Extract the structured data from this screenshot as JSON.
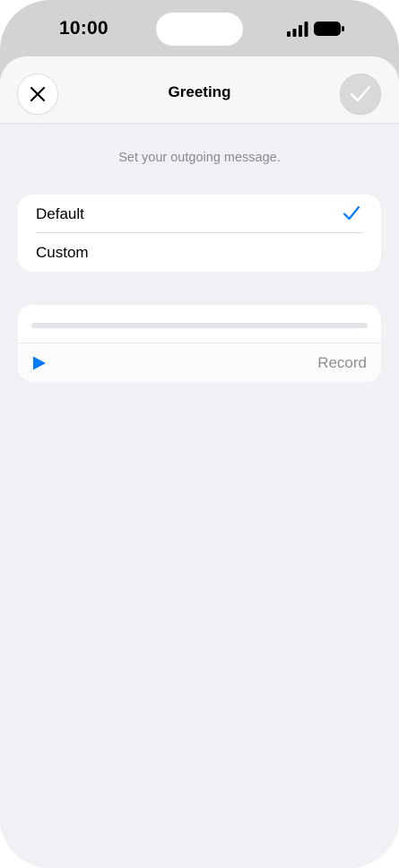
{
  "status_bar": {
    "time": "10:00"
  },
  "nav": {
    "title": "Greeting",
    "close_icon": "close-icon",
    "confirm_icon": "checkmark-icon"
  },
  "subtitle": "Set your outgoing message.",
  "options": [
    {
      "label": "Default",
      "selected": true
    },
    {
      "label": "Custom",
      "selected": false
    }
  ],
  "player": {
    "progress": 0,
    "play_icon": "play-icon",
    "record_label": "Record"
  },
  "colors": {
    "accent": "#007aff",
    "sheet_background": "#f0f0f5",
    "disabled_text": "#8e8e93"
  }
}
